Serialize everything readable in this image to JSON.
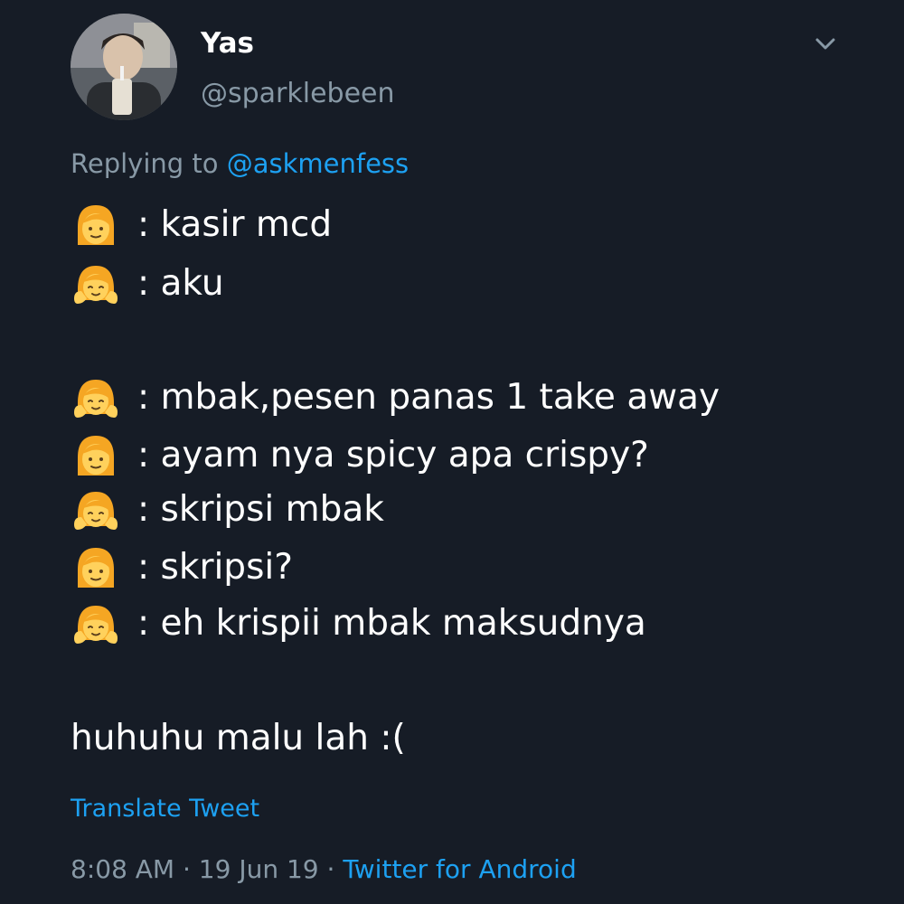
{
  "user": {
    "display_name": "Yas",
    "handle": "@sparklebeen",
    "avatar_icon": "profile-photo"
  },
  "menu_icon": "chevron-down-icon",
  "reply": {
    "prefix": "Replying to ",
    "mention": "@askmenfess"
  },
  "conversation": [
    {
      "speaker": "cashier",
      "emoji": "woman-emoji",
      "text": ": kasir mcd"
    },
    {
      "speaker": "me",
      "emoji": "woman-gesturing-ok-emoji",
      "text": ": aku"
    },
    {
      "speaker": "me",
      "emoji": "woman-gesturing-ok-emoji",
      "text": ": mbak,pesen panas 1 take away"
    },
    {
      "speaker": "cashier",
      "emoji": "woman-emoji",
      "text": ": ayam nya spicy apa crispy?"
    },
    {
      "speaker": "me",
      "emoji": "woman-gesturing-ok-emoji",
      "text": ": skripsi mbak"
    },
    {
      "speaker": "cashier",
      "emoji": "woman-emoji",
      "text": ": skripsi?"
    },
    {
      "speaker": "me",
      "emoji": "woman-gesturing-ok-emoji",
      "text": ": eh krispii mbak maksudnya"
    }
  ],
  "closing_text": "huhuhu malu lah :(",
  "translate_label": "Translate Tweet",
  "meta": {
    "time": "8:08 AM",
    "separator": " · ",
    "date": "19 Jun 19",
    "source": "Twitter for Android"
  },
  "colors": {
    "background": "#161c26",
    "text_primary": "#ffffff",
    "text_secondary": "#8899a6",
    "accent": "#1da1f2",
    "emoji_skin": "#ffd15c",
    "emoji_hair": "#f5a623"
  }
}
